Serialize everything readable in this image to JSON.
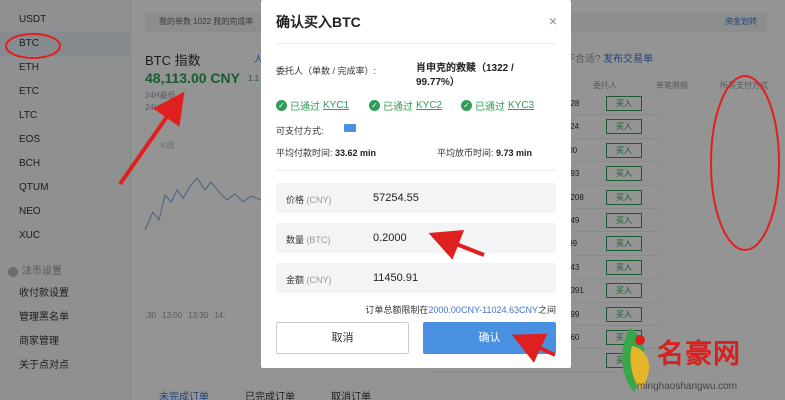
{
  "sidebar": {
    "coins": [
      "USDT",
      "BTC",
      "ETH",
      "ETC",
      "LTC",
      "EOS",
      "BCH",
      "QTUM",
      "NEO",
      "XUC"
    ],
    "section_title": "法币设置",
    "links": [
      "收付款设置",
      "管理黑名单",
      "商家管理",
      "关于点对点"
    ]
  },
  "topbar": {
    "text": "我的单数  1022   我的完成率",
    "right_link": "资金划转"
  },
  "index": {
    "title": "BTC 指数",
    "side_link": "人",
    "price": "48,113.00 CNY",
    "price_small": "1.1",
    "label_24h_1": "24H最低",
    "label_24h_2": "24H最高",
    "kline": "K线",
    "times": [
      ":30",
      "13:00",
      "13:30",
      "14:"
    ]
  },
  "bottom_tabs": [
    "未完成订单",
    "已完成订单",
    "取消订单"
  ],
  "right_panel": {
    "question": "价格不合适?",
    "publish_link": "发布交易单",
    "col_trader": "委托人",
    "col_limit": "单笔限额",
    "col_pay": "所有支付方式",
    "v_badge": "V",
    "buy_label": "买入",
    "rows": [
      {
        "name": "信秒放",
        "range": "400-228128"
      },
      {
        "name": "的救赎",
        "range": "2000-11024"
      },
      {
        "name": "秒放",
        "range": "400-20000"
      },
      {
        "name": "杨**",
        "range": "2000-17093"
      },
      {
        "name": "诚信哥",
        "range": "20000-306208"
      },
      {
        "name": "看天下",
        "range": "5001-58149"
      },
      {
        "name": "马的爸爸",
        "range": "400-49999"
      },
      {
        "name": "黄**",
        "range": "400-122643"
      },
      {
        "name": "ZhiSui",
        "range": "10000-153391"
      },
      {
        "name": "天秒放",
        "range": "1000-25999"
      },
      {
        "name": "又马德里",
        "range": "6000-88560"
      },
      {
        "name": "蒋**",
        "range": "500-1"
      }
    ]
  },
  "modal": {
    "title": "确认买入BTC",
    "close_glyph": "×",
    "trader_label": "委托人（单数 / 完成率）:",
    "trader_name": "肖申克的救赎（1322 / 99.77%）",
    "kyc_prefix": "已通过",
    "kyc": [
      "KYC1",
      "KYC2",
      "KYC3"
    ],
    "pay_label": "可支付方式:",
    "avg_pay_label": "平均付款时间:",
    "avg_pay_value": "33.62 min",
    "avg_release_label": "平均放币时间:",
    "avg_release_value": "9.73 min",
    "fields": [
      {
        "label": "价格",
        "unit": "(CNY)",
        "value": "57254.55"
      },
      {
        "label": "数量",
        "unit": "(BTC)",
        "value": "0.2000"
      },
      {
        "label": "金额",
        "unit": "(CNY)",
        "value": "11450.91"
      }
    ],
    "limit_prefix": "订单总额限制在",
    "limit_range": "2000.00CNY-11024.63CNY",
    "limit_suffix": "之间",
    "cancel": "取消",
    "confirm": "确认"
  },
  "watermark": {
    "cn": "名豪网",
    "en": "minghaoshangwu.com"
  },
  "colors": {
    "accent_blue": "#4a90e2",
    "link_blue": "#3a75d6",
    "green": "#2f9e55",
    "annotation_red": "#e0201f"
  }
}
